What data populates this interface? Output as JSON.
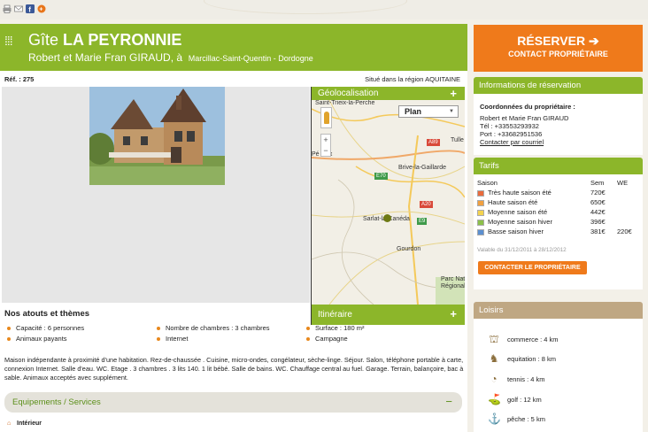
{
  "toolbar": {
    "icons": [
      "print-icon",
      "email-icon",
      "facebook-icon",
      "google-plus-icon"
    ]
  },
  "header": {
    "title_prefix": "Gîte ",
    "title_name": "LA PEYRONNIE",
    "owner": "Robert et Marie Fran GIRAUD, à",
    "location": "Marcillac-Saint-Quentin - Dordogne"
  },
  "ref": "Réf. : 275",
  "region": "Situé dans la région AQUITAINE",
  "geo": {
    "title": "Géolocalisation",
    "plus": "+",
    "map_type": "Plan",
    "zoom_in": "+",
    "zoom_out": "−",
    "labels": {
      "top": "Saint-Trieix-la-Perche",
      "perigueux": "Pé  ieux",
      "tulle": "Tulle",
      "brive": "Brive-la-Gaillarde",
      "sarlat": "Sarlat-la-Canéda",
      "gourdon": "Gourdon",
      "parc": "Parc Nat\nRégional"
    },
    "roads": {
      "a89": "A89",
      "e70": "E70",
      "a20": "A20",
      "e9": "E9"
    }
  },
  "itineraire": {
    "title": "Itinéraire",
    "plus": "+"
  },
  "atouts": {
    "title": "Nos atouts et thèmes",
    "items": [
      "Capacité : 6 personnes",
      "Nombre de chambres : 3 chambres",
      "Surface : 180 m²",
      "Animaux payants",
      "Internet",
      "Campagne"
    ]
  },
  "description": "Maison indépendante à proximité d'une habitation. Rez-de-chaussée . Cuisine, micro-ondes, congélateur, sèche-linge. Séjour. Salon, téléphone portable à carte, connexion Internet. Salle d'eau. WC. Etage . 3 chambres . 3 lits 140. 1 lit bébé. Salle de bains. WC. Chauffage central au fuel. Garage. Terrain, balançoire, bac à sable. Animaux acceptés avec supplément.",
  "equipements": {
    "title": "Equipements / Services",
    "toggle": "−",
    "interieur": "Intérieur"
  },
  "reserve": {
    "line1": "RÉSERVER ➔",
    "line2": "CONTACT PROPRIÉTAIRE"
  },
  "infos": {
    "title": "Informations de réservation",
    "coord_title": "Coordonnées du propriétaire :",
    "name": "Robert et Marie Fran GIRAUD",
    "tel": "Tél : +33553293932",
    "port": "Port : +33682951536",
    "contact_link": "Contacter par courriel"
  },
  "tarifs": {
    "title": "Tarifs",
    "head": {
      "saison": "Saison",
      "sem": "Sem",
      "we": "WE"
    },
    "rows": [
      {
        "label": "Très haute saison été",
        "sem": "720€",
        "we": "",
        "color": "#e96b3c"
      },
      {
        "label": "Haute saison été",
        "sem": "650€",
        "we": "",
        "color": "#f0a040"
      },
      {
        "label": "Moyenne saison été",
        "sem": "442€",
        "we": "",
        "color": "#f3d24e"
      },
      {
        "label": "Moyenne saison hiver",
        "sem": "396€",
        "we": "",
        "color": "#8cc04a"
      },
      {
        "label": "Basse saison hiver",
        "sem": "381€",
        "we": "220€",
        "color": "#5b8fd0"
      }
    ],
    "validity": "Valable du 31/12/2011 à 28/12/2012",
    "contact_button": "CONTACTER LE PROPRIÉTAIRE"
  },
  "loisirs": {
    "title": "Loisirs",
    "items": [
      {
        "label": "commerce : 4 km",
        "icon": "shop-icon"
      },
      {
        "label": "equitation : 8 km",
        "icon": "horse-icon"
      },
      {
        "label": "tennis : 4 km",
        "icon": "tennis-icon"
      },
      {
        "label": "golf : 12 km",
        "icon": "golf-icon"
      },
      {
        "label": "pêche : 5 km",
        "icon": "fishing-icon"
      }
    ]
  }
}
